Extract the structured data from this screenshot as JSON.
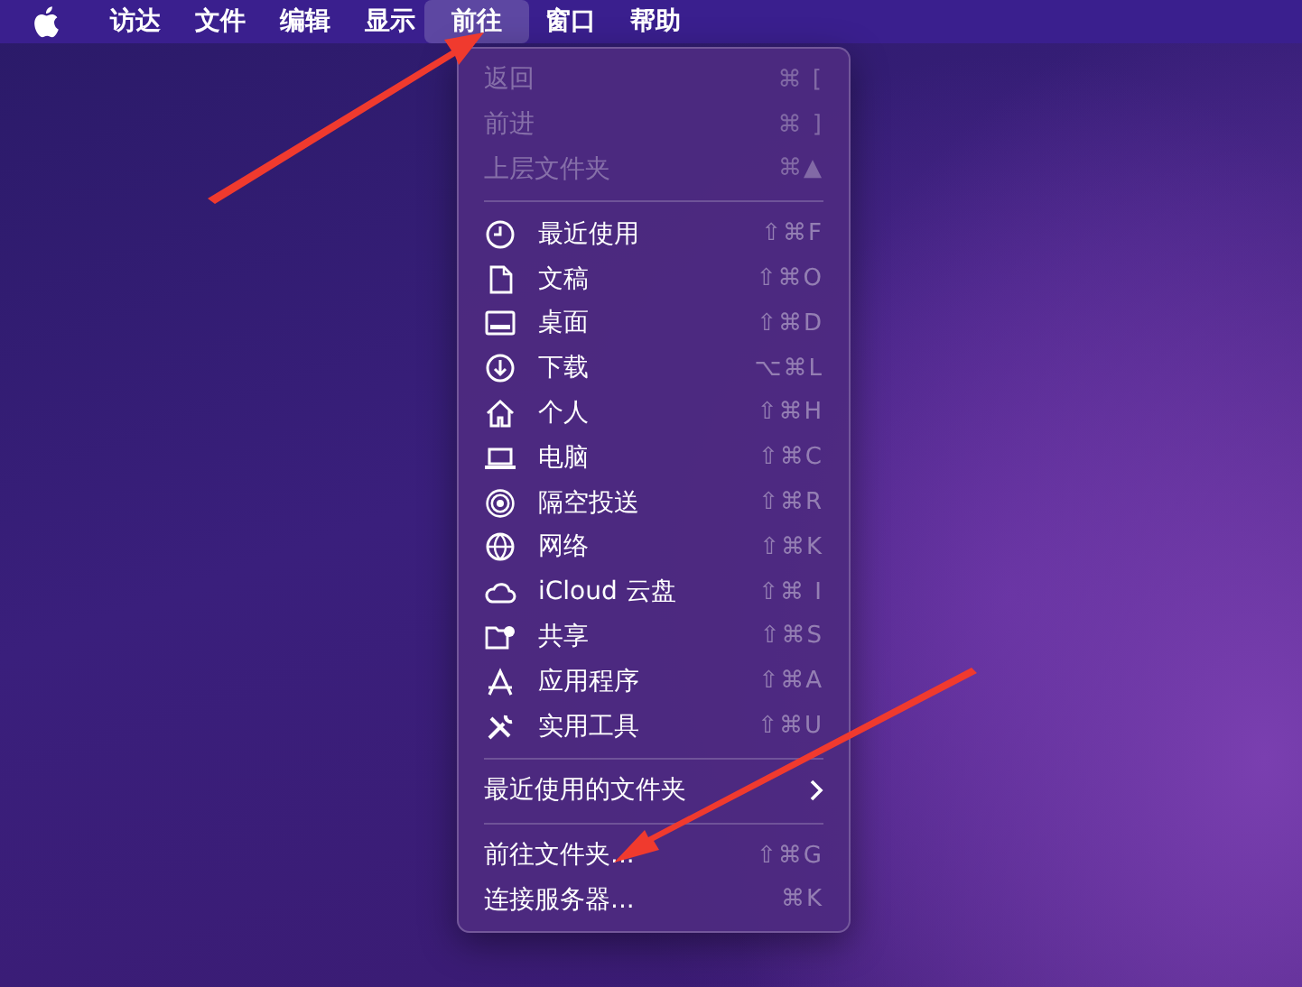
{
  "menu_bar": {
    "items": [
      {
        "label": "访达",
        "selected": false
      },
      {
        "label": "文件",
        "selected": false
      },
      {
        "label": "编辑",
        "selected": false
      },
      {
        "label": "显示",
        "selected": false
      },
      {
        "label": "前往",
        "selected": true
      },
      {
        "label": "窗口",
        "selected": false
      },
      {
        "label": "帮助",
        "selected": false
      }
    ]
  },
  "menu": {
    "groups": [
      {
        "items": [
          {
            "kind": "plain",
            "label": "返回",
            "shortcut": "⌘ [",
            "disabled": true
          },
          {
            "kind": "plain",
            "label": "前进",
            "shortcut": "⌘ ]",
            "disabled": true
          },
          {
            "kind": "plain",
            "label": "上层文件夹",
            "shortcut": "⌘▲",
            "disabled": true
          }
        ]
      },
      {
        "items": [
          {
            "kind": "icon",
            "label": "最近使用",
            "shortcut": "⇧⌘F",
            "disabled": false
          },
          {
            "kind": "icon",
            "label": "文稿",
            "shortcut": "⇧⌘O",
            "disabled": false
          },
          {
            "kind": "icon",
            "label": "桌面",
            "shortcut": "⇧⌘D",
            "disabled": false
          },
          {
            "kind": "icon",
            "label": "下载",
            "shortcut": "⌥⌘L",
            "disabled": false
          },
          {
            "kind": "icon",
            "label": "个人",
            "shortcut": "⇧⌘H",
            "disabled": false
          },
          {
            "kind": "icon",
            "label": "电脑",
            "shortcut": "⇧⌘C",
            "disabled": false
          },
          {
            "kind": "icon",
            "label": "隔空投送",
            "shortcut": "⇧⌘R",
            "disabled": false
          },
          {
            "kind": "icon",
            "label": "网络",
            "shortcut": "⇧⌘K",
            "disabled": false
          },
          {
            "kind": "icon",
            "label": "iCloud 云盘",
            "shortcut": "⇧⌘ I",
            "disabled": false
          },
          {
            "kind": "icon",
            "label": "共享",
            "shortcut": "⇧⌘S",
            "disabled": false
          },
          {
            "kind": "icon",
            "label": "应用程序",
            "shortcut": "⇧⌘A",
            "disabled": false
          },
          {
            "kind": "icon",
            "label": "实用工具",
            "shortcut": "⇧⌘U",
            "disabled": false
          }
        ]
      },
      {
        "items": [
          {
            "kind": "submenu",
            "label": "最近使用的文件夹",
            "disabled": false
          }
        ]
      },
      {
        "items": [
          {
            "kind": "plain",
            "label": "前往文件夹...",
            "shortcut": "⇧⌘G",
            "disabled": false
          },
          {
            "kind": "plain",
            "label": "连接服务器...",
            "shortcut": "⌘K",
            "disabled": false
          }
        ]
      }
    ]
  }
}
